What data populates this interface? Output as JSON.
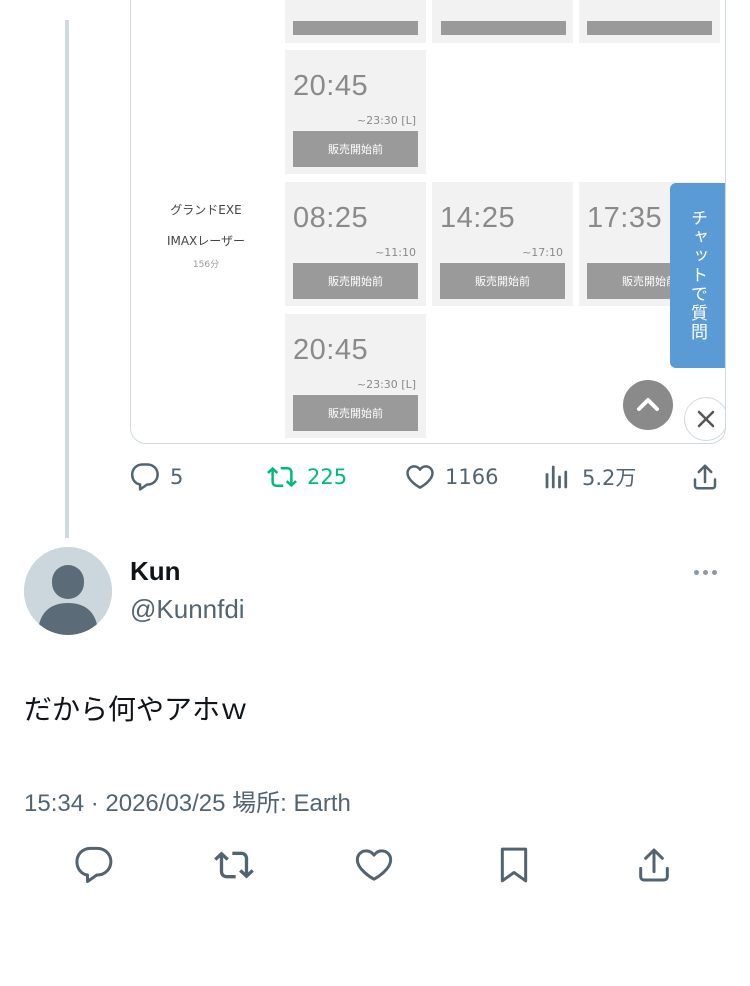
{
  "embed": {
    "rows": [
      {
        "hall_name": "",
        "hall_format": "",
        "hall_duration": "",
        "cells": [
          {
            "time": "20:45",
            "end": "~23:30 [L]",
            "button": "販売開始前"
          }
        ]
      },
      {
        "hall_name": "グランドEXE",
        "hall_format": "IMAXレーザー",
        "hall_duration": "156分",
        "cells": [
          {
            "time": "08:25",
            "end": "~11:10",
            "button": "販売開始前"
          },
          {
            "time": "14:25",
            "end": "~17:10",
            "button": "販売開始前"
          },
          {
            "time": "17:35",
            "end": "",
            "button": "販売開始前"
          }
        ]
      },
      {
        "hall_name": "",
        "hall_format": "",
        "hall_duration": "",
        "cells": [
          {
            "time": "20:45",
            "end": "~23:30 [L]",
            "button": "販売開始前"
          }
        ]
      }
    ],
    "chat_tab_label": "チャットで質問",
    "icons": {
      "scroll_up": "chevron-up-icon",
      "close": "close-icon"
    }
  },
  "tweet_actions": {
    "replies": "5",
    "retweets": "225",
    "likes": "1166",
    "views": "5.2万",
    "retweet_color": "#00ba7c"
  },
  "reply": {
    "name": "Kun",
    "handle": "@Kunnfdi",
    "text": "だから何やアホｗ",
    "meta": "15:34 · 2026/03/25 場所: Earth"
  }
}
